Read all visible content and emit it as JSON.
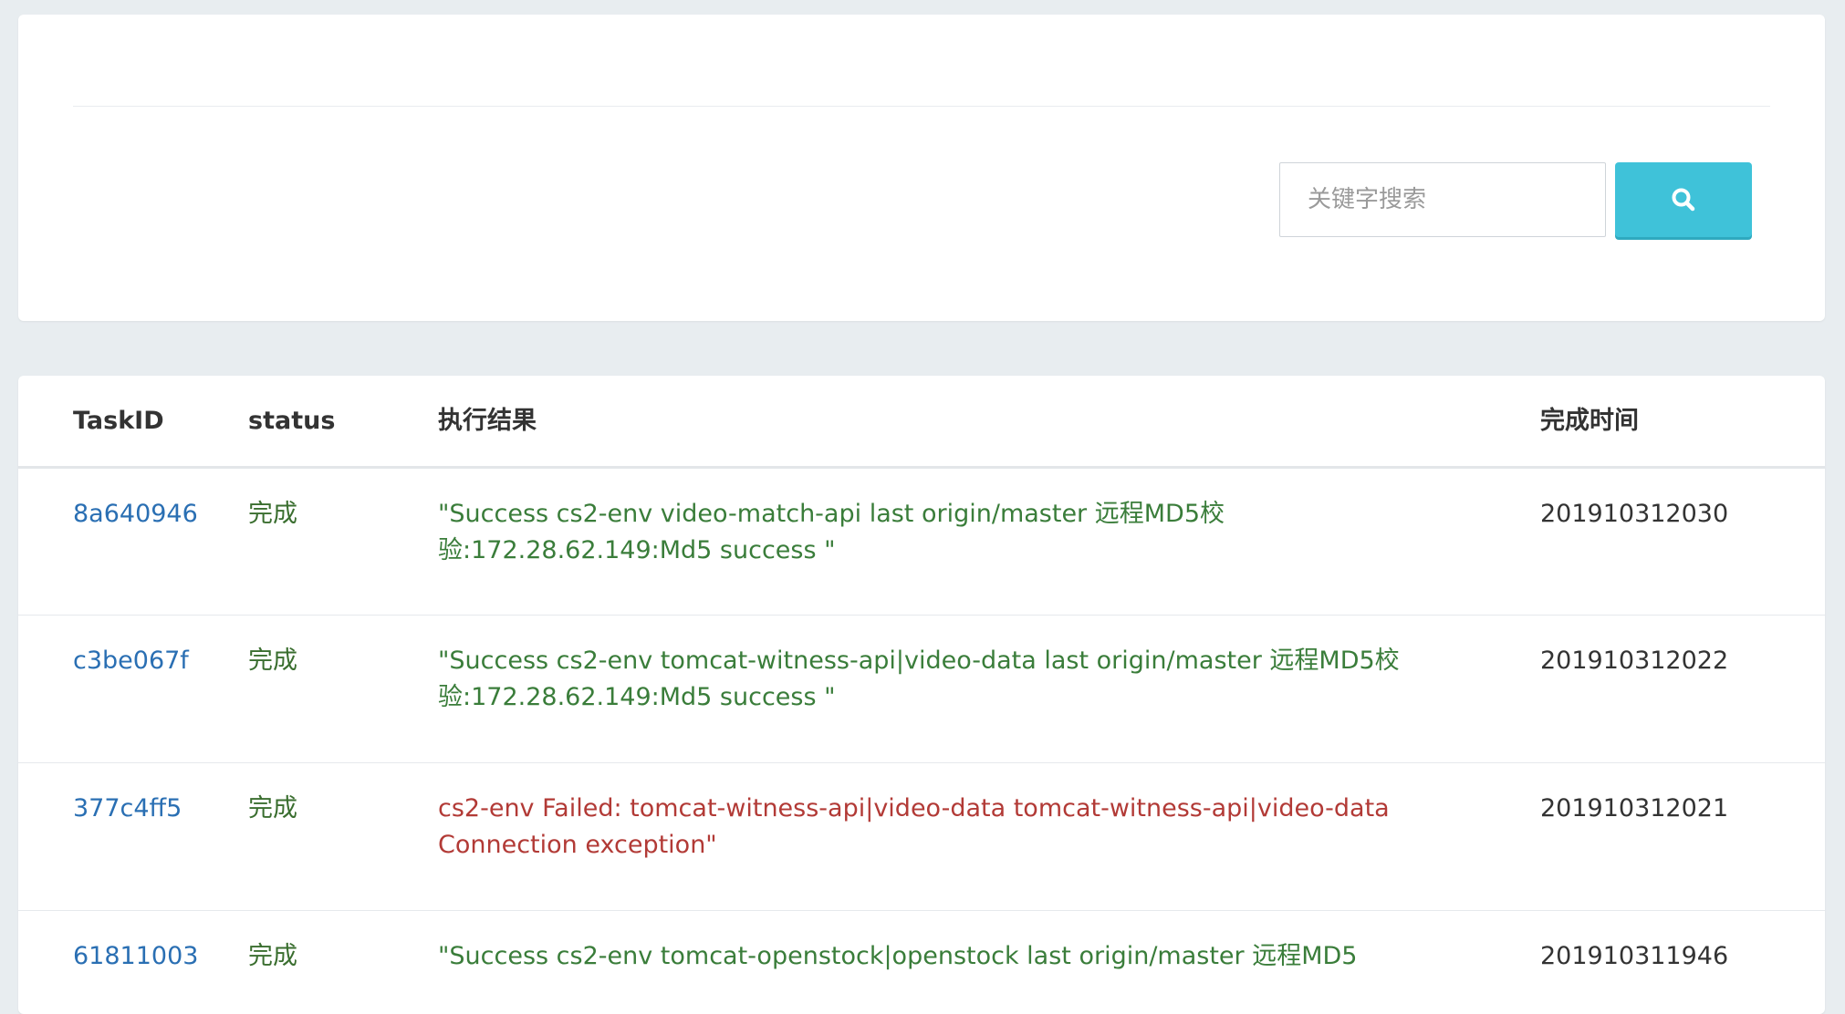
{
  "search": {
    "placeholder": "关键字搜索",
    "button_icon": "search-icon"
  },
  "colors": {
    "accent": "#3fc2d9",
    "link": "#2a6fb3",
    "success": "#3a7d3a",
    "failed": "#b23a36"
  },
  "table": {
    "headers": {
      "task_id": "TaskID",
      "status": "status",
      "result": "执行结果",
      "time": "完成时间"
    },
    "rows": [
      {
        "task_id": "8a640946",
        "status": "完成",
        "result": "\"Success cs2-env video-match-api last origin/master 远程MD5校验:172.28.62.149:Md5 success \"",
        "result_state": "success",
        "time": "201910312030"
      },
      {
        "task_id": "c3be067f",
        "status": "完成",
        "result": "\"Success cs2-env tomcat-witness-api|video-data last origin/master 远程MD5校验:172.28.62.149:Md5 success \"",
        "result_state": "success",
        "time": "201910312022"
      },
      {
        "task_id": "377c4ff5",
        "status": "完成",
        "result": "cs2-env Failed: tomcat-witness-api|video-data tomcat-witness-api|video-data Connection exception\"",
        "result_state": "failed",
        "time": "201910312021"
      },
      {
        "task_id": "61811003",
        "status": "完成",
        "result": "\"Success cs2-env tomcat-openstock|openstock last origin/master 远程MD5",
        "result_state": "success",
        "time": "201910311946"
      }
    ]
  }
}
